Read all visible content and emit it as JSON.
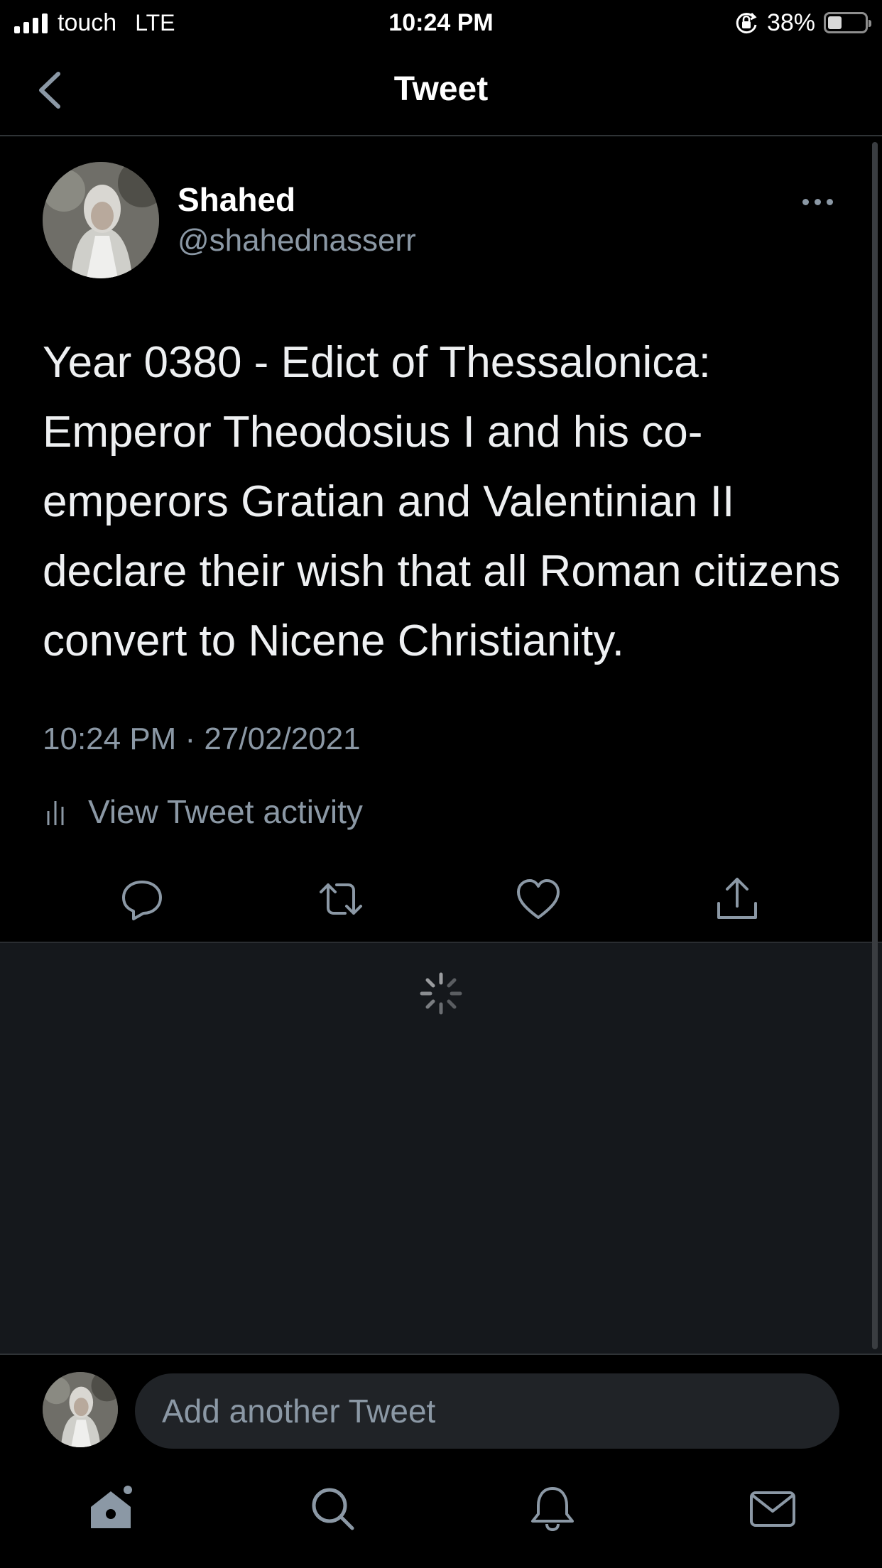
{
  "status_bar": {
    "carrier": "touch",
    "network": "LTE",
    "time": "10:24 PM",
    "battery_text": "38%",
    "battery_level": 0.38,
    "icons": [
      "signal-icon",
      "orientation-lock-icon",
      "battery-icon"
    ]
  },
  "header": {
    "title": "Tweet",
    "back_icon": "chevron-left-icon"
  },
  "tweet": {
    "display_name": "Shahed",
    "handle": "@shahednasserr",
    "text": "Year 0380 - Edict of Thessalonica: Emperor Theodosius I and his co-emperors Gratian and Valentinian II declare their wish that all Roman citizens convert to Nicene Christianity.",
    "timestamp": "10:24 PM · 27/02/2021",
    "activity_label": "View Tweet activity",
    "actions": [
      "reply-icon",
      "retweet-icon",
      "like-icon",
      "share-icon"
    ]
  },
  "reply_bar": {
    "placeholder": "Add another Tweet"
  },
  "tabs": [
    "home-icon",
    "search-icon",
    "notifications-icon",
    "messages-icon"
  ],
  "colors": {
    "background": "#000000",
    "secondary_text": "#8b98a5",
    "divider": "#2f3336",
    "replies_background": "#15181c"
  }
}
